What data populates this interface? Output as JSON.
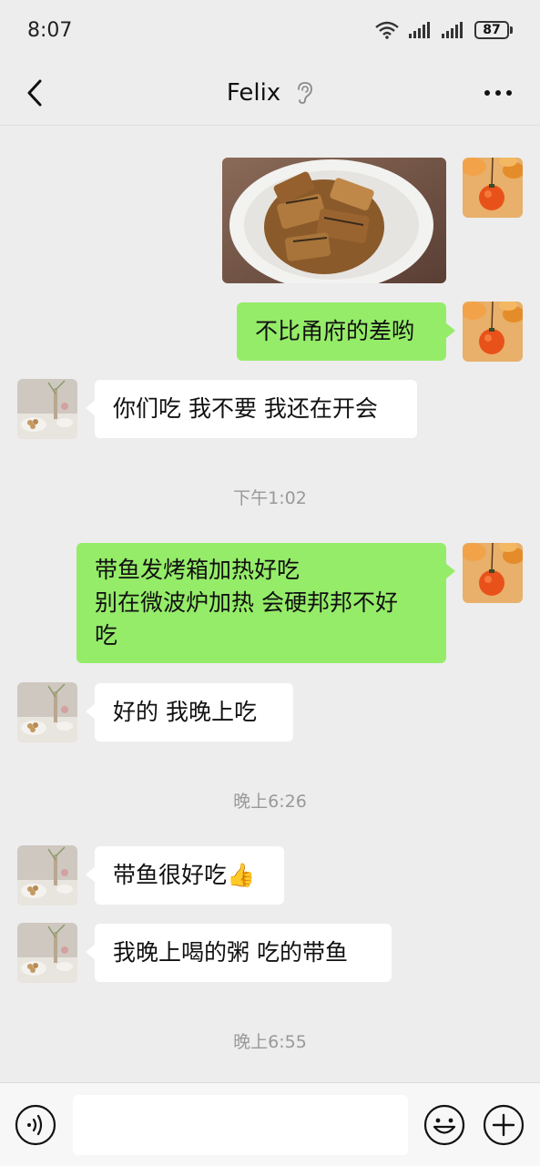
{
  "status": {
    "time": "8:07",
    "battery": "87"
  },
  "header": {
    "title": "Felix"
  },
  "messages": [
    {
      "from": "me",
      "type": "image",
      "image_desc": "fried fish in white bowl"
    },
    {
      "from": "me",
      "text": "不比甬府的差哟"
    },
    {
      "from": "other",
      "text": "你们吃 我不要 我还在开会"
    },
    {
      "type": "time",
      "text": "下午1:02"
    },
    {
      "from": "me",
      "lines": [
        "带鱼发烤箱加热好吃",
        "别在微波炉加热 会硬邦邦不好",
        "吃"
      ]
    },
    {
      "from": "other",
      "text": "好的 我晚上吃"
    },
    {
      "type": "time",
      "text": "晚上6:26"
    },
    {
      "from": "other",
      "text": "带鱼很好吃👍"
    },
    {
      "from": "other",
      "text": "我晚上喝的粥 吃的带鱼"
    },
    {
      "type": "time",
      "text": "晚上6:55"
    }
  ],
  "input": {
    "placeholder": ""
  },
  "colors": {
    "my_bubble": "#95ec69",
    "their_bubble": "#ffffff",
    "background": "#ededed"
  }
}
